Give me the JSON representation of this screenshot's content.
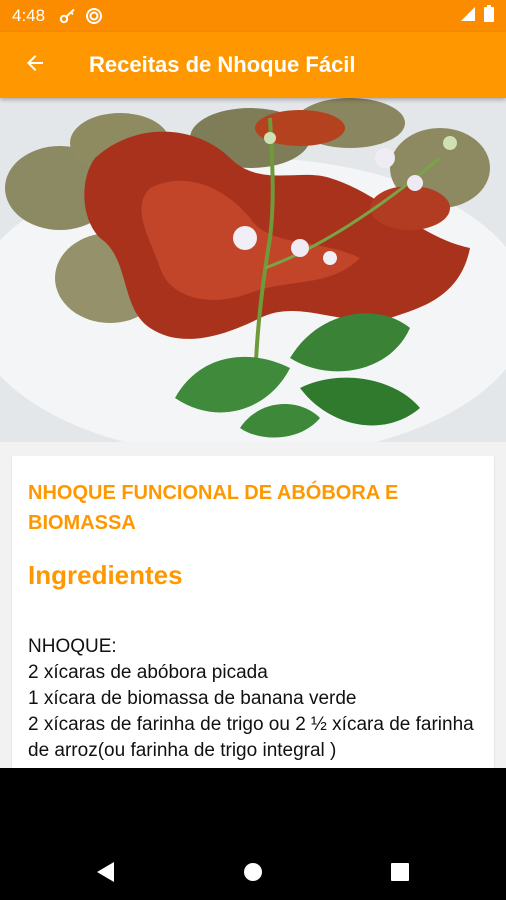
{
  "status_bar": {
    "time": "4:48",
    "icons": [
      "key-icon",
      "sync-icon",
      "signal-icon",
      "battery-icon"
    ]
  },
  "app_bar": {
    "title": "Receitas de Nhoque Fácil",
    "back_icon": "arrow-back-icon"
  },
  "colors": {
    "accent": "#ff9800",
    "status_bar": "#fb8c00",
    "background": "#f2f2f2"
  },
  "recipe": {
    "title": "NHOQUE FUNCIONAL DE ABÓBORA E BIOMASSA",
    "section_title": "Ingredientes",
    "ingredients": [
      "NHOQUE:",
      "2 xícaras de abóbora picada",
      "1 xícara de biomassa de banana verde",
      "2 xícaras de farinha de trigo ou 2 ½ xícara de farinha de arroz(ou farinha de trigo integral )"
    ]
  },
  "nav_bar": {
    "buttons": [
      "back-triangle-icon",
      "home-circle-icon",
      "recents-square-icon"
    ]
  }
}
